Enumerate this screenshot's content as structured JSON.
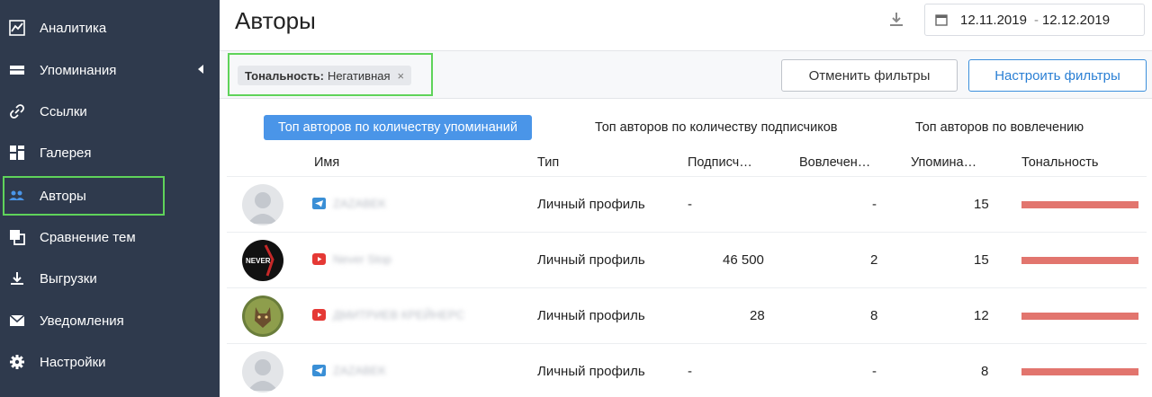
{
  "sidebar": {
    "items": [
      {
        "label": "Аналитика",
        "icon": "chart-icon"
      },
      {
        "label": "Упоминания",
        "icon": "mentions-icon"
      },
      {
        "label": "Ссылки",
        "icon": "link-icon"
      },
      {
        "label": "Галерея",
        "icon": "gallery-icon"
      },
      {
        "label": "Авторы",
        "icon": "authors-icon"
      },
      {
        "label": "Сравнение тем",
        "icon": "compare-icon"
      },
      {
        "label": "Выгрузки",
        "icon": "download-icon"
      },
      {
        "label": "Уведомления",
        "icon": "mail-icon"
      },
      {
        "label": "Настройки",
        "icon": "gear-icon"
      }
    ],
    "active": "Авторы"
  },
  "header": {
    "title": "Авторы",
    "date_from": "12.11.2019",
    "date_sep": "-",
    "date_to": "12.12.2019"
  },
  "filters": {
    "chip_key": "Тональность:",
    "chip_value": "Негативная",
    "chip_close": "×",
    "reset_label": "Отменить фильтры",
    "setup_label": "Настроить фильтры"
  },
  "tabs": [
    {
      "label": "Топ авторов по количеству упоминаний",
      "active": true
    },
    {
      "label": "Топ авторов по количеству подписчиков",
      "active": false
    },
    {
      "label": "Топ авторов по вовлечению",
      "active": false
    }
  ],
  "table": {
    "columns": [
      "Имя",
      "Тип",
      "Подписч…",
      "Вовлечен…",
      "Упомина…",
      "Тональность"
    ],
    "rows": [
      {
        "source": "telegram",
        "name": "ZAZABEK",
        "type": "Личный профиль",
        "subscribers": "-",
        "engagement": "-",
        "mentions": "15",
        "negative_share": 1.0
      },
      {
        "source": "youtube",
        "name": "Never Stop",
        "type": "Личный профиль",
        "subscribers": "46 500",
        "engagement": "2",
        "mentions": "15",
        "negative_share": 1.0
      },
      {
        "source": "youtube",
        "name": "ДМИТРИЕВ КРЕЙНЕРС",
        "type": "Личный профиль",
        "subscribers": "28",
        "engagement": "8",
        "mentions": "12",
        "negative_share": 1.0
      },
      {
        "source": "telegram",
        "name": "ZAZABEK",
        "type": "Личный профиль",
        "subscribers": "-",
        "engagement": "-",
        "mentions": "8",
        "negative_share": 1.0
      }
    ]
  },
  "colors": {
    "sidebar_bg": "#2f3a4d",
    "accent_blue": "#4a95e8",
    "highlight_green": "#5fd35a",
    "negative": "#e2756e",
    "telegram": "#3a8fd6",
    "youtube": "#e53935"
  }
}
